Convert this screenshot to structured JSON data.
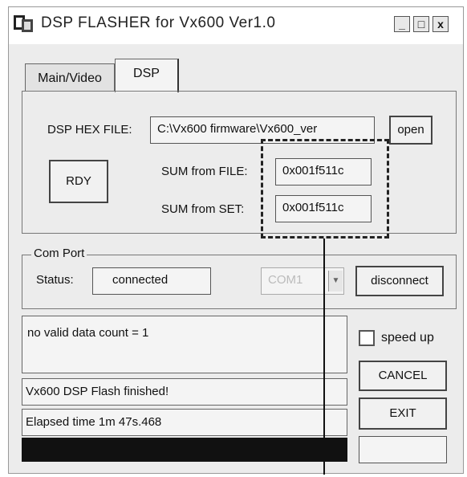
{
  "window": {
    "title": "DSP FLASHER for Vx600  Ver1.0",
    "title_icon": "app-icon",
    "minimize": "_",
    "maximize": "□",
    "close": "x"
  },
  "tabs": [
    {
      "label": "Main/Video"
    },
    {
      "label": "DSP"
    }
  ],
  "dsp": {
    "hex_file_label": "DSP HEX FILE:",
    "hex_file_value": "C:\\Vx600 firmware\\Vx600_ver",
    "open_label": "open",
    "rdy_label": "RDY",
    "sum_file_label": "SUM from FILE:",
    "sum_file_value": "0x001f511c",
    "sum_set_label": "SUM from SET:",
    "sum_set_value": "0x001f511c"
  },
  "com_port": {
    "group_label": "Com Port",
    "status_label": "Status:",
    "status_value": "connected",
    "port_value": "COM1",
    "disconnect_label": "disconnect"
  },
  "log": {
    "message1": "no valid data count = 1",
    "message2": "Vx600 DSP Flash finished!",
    "message3": "Elapsed time 1m 47s.468"
  },
  "side": {
    "speed_up_label": "speed up",
    "cancel_label": "CANCEL",
    "exit_label": "EXIT"
  }
}
